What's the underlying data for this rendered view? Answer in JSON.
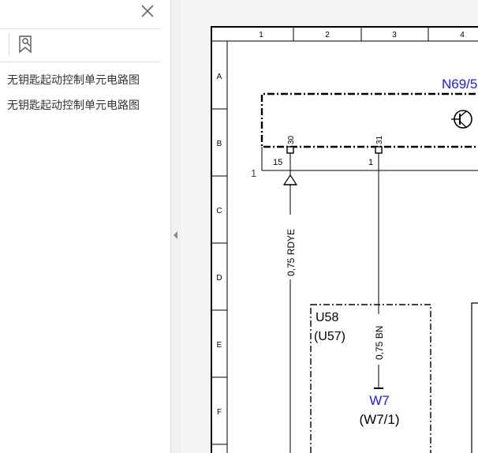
{
  "sidebar": {
    "close_icon": "close-icon",
    "bookmark_icon": "bookmark-search-icon",
    "items": [
      {
        "label": "无钥匙起动控制单元电路图"
      },
      {
        "label": "无钥匙起动控制单元电路图"
      }
    ]
  },
  "splitter": {
    "icon": "chevron-left-icon"
  },
  "diagram": {
    "columns": [
      "1",
      "2",
      "3",
      "4"
    ],
    "rows": [
      "A",
      "B",
      "C",
      "D",
      "E",
      "F"
    ],
    "module_label": "N69/5",
    "pin_30": "30",
    "pin_31": "31",
    "terminal_15": "15",
    "terminal_1": "1",
    "line_marker": "1",
    "wire_rdye": "0,75 RDYE",
    "wire_bn": "0,75 BN",
    "component_u58": "U58",
    "component_u57": "(U57)",
    "ground_w7": "W7",
    "ground_w7_1": "(W7/1)",
    "colors": {
      "blue_label": "#1a1aff",
      "line": "#000000"
    }
  }
}
